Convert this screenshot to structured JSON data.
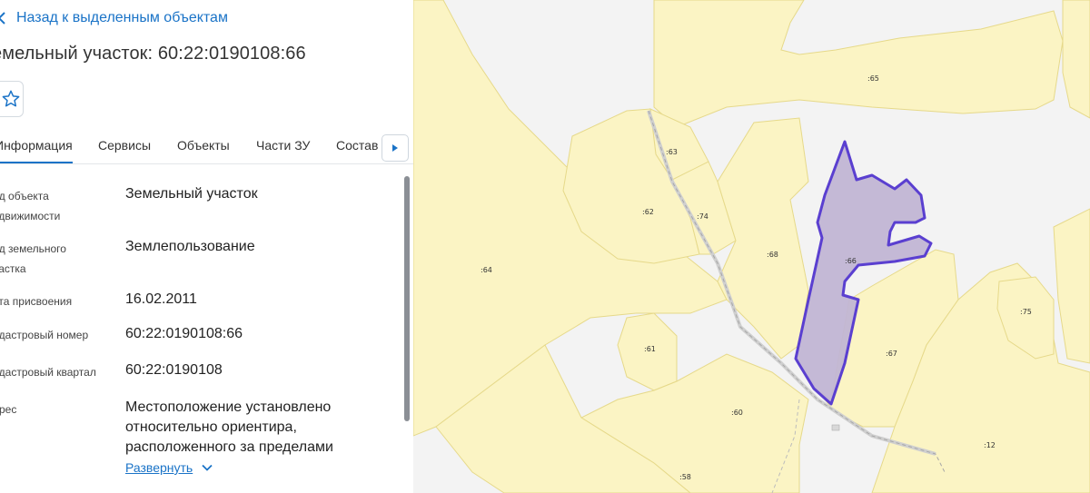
{
  "panel": {
    "back_label": "Назад к выделенным объектам",
    "title": "емельный участок: 60:22:0190108:66",
    "tabs": [
      {
        "label": "Информация",
        "active": true
      },
      {
        "label": "Сервисы",
        "active": false
      },
      {
        "label": "Объекты",
        "active": false
      },
      {
        "label": "Части ЗУ",
        "active": false
      },
      {
        "label": "Состав",
        "active": false
      }
    ],
    "rows": [
      {
        "label_lines": [
          "ид объекта",
          "едвижимости"
        ],
        "value_lines": [
          "Земельный участок"
        ]
      },
      {
        "label_lines": [
          "ид земельного",
          "частка"
        ],
        "value_lines": [
          "Землепользование"
        ]
      },
      {
        "label_lines": [
          "ата присвоения"
        ],
        "value_lines": [
          "16.02.2011"
        ]
      },
      {
        "label_lines": [
          "адастровый номер"
        ],
        "value_lines": [
          "60:22:0190108:66"
        ]
      },
      {
        "label_lines": [
          "адастровый квартал"
        ],
        "value_lines": [
          "60:22:0190108"
        ]
      },
      {
        "label_lines": [
          "дрес"
        ],
        "value_lines": [
          "Местоположение установлено",
          "относительно ориентира,",
          "расположенного за пределами"
        ]
      }
    ],
    "expand_label": "Развернуть"
  },
  "icons": {
    "back": "chevron-left-icon",
    "favorite": "star-outline-icon",
    "tab_next": "triangle-right-icon",
    "expand": "chevron-down-icon"
  },
  "colors": {
    "accent": "#1a73c7",
    "parcel_fill": "#fbf4c4",
    "parcel_stroke": "#e6d98a",
    "map_background": "#f3f3f3",
    "selected_fill": "#c1b5d4",
    "selected_stroke": "#5a3fd0"
  },
  "map": {
    "parcels": [
      {
        "label": ":65"
      },
      {
        "label": ":63"
      },
      {
        "label": ":62"
      },
      {
        "label": ":74"
      },
      {
        "label": ":64"
      },
      {
        "label": ":68"
      },
      {
        "label": ":66"
      },
      {
        "label": ":75"
      },
      {
        "label": ":61"
      },
      {
        "label": ":67"
      },
      {
        "label": ":60"
      },
      {
        "label": ":12"
      },
      {
        "label": ":58"
      }
    ],
    "selected_parcel": ":66"
  }
}
